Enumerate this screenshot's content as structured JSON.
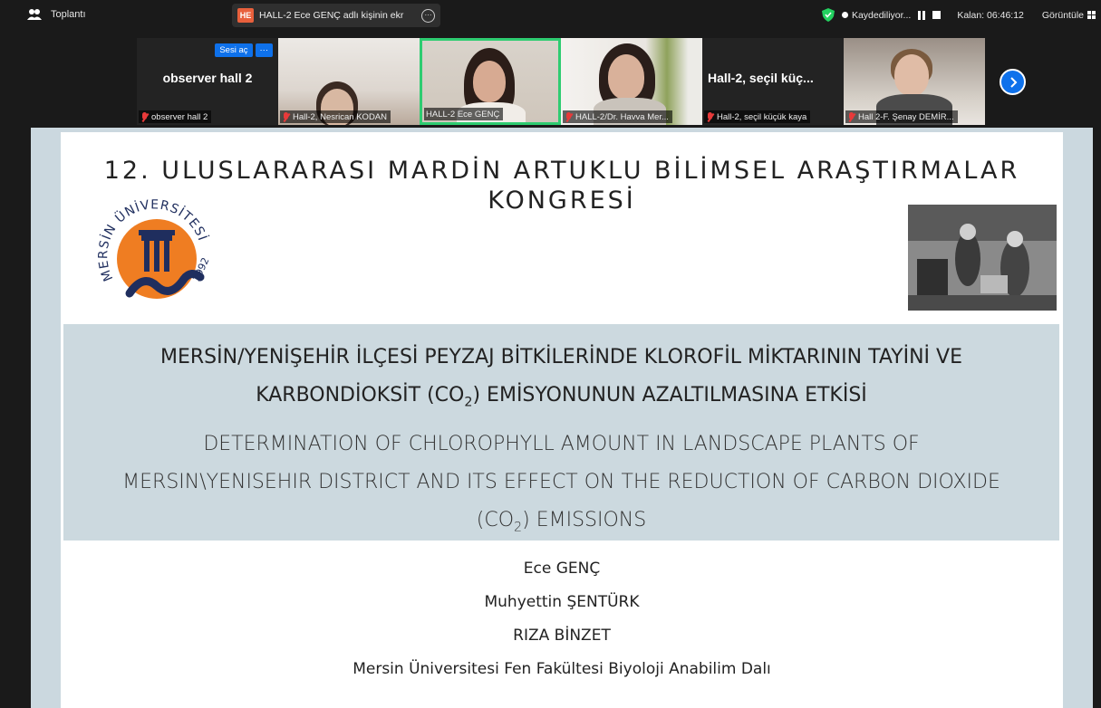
{
  "topbar": {
    "app_label": "Toplantı",
    "share_badge": "HE",
    "share_text": "HALL-2 Ece GENÇ adlı kişinin ekr",
    "recording_label": "Kaydediliyor...",
    "remaining_label": "Kalan: 06:46:12",
    "view_label": "Görüntüle"
  },
  "participants": [
    {
      "big_name": "observer hall 2",
      "label": "observer hall 2",
      "unmute": "Sesi aç",
      "more": "···"
    },
    {
      "label": "Hall-2, Nesrican KODAN"
    },
    {
      "label": "HALL-2 Ece GENÇ"
    },
    {
      "label": "HALL-2/Dr. Havva Mer..."
    },
    {
      "big_name": "Hall-2, seçil küç...",
      "label": "Hall-2, seçil küçük kaya"
    },
    {
      "label": "Hall 2-F. Şenay DEMİR..."
    }
  ],
  "slide": {
    "congress_line1": "12. ULUSLARARASI MARDİN ARTUKLU BİLİMSEL ARAŞTIRMALAR",
    "congress_line2": "KONGRESİ",
    "logo": {
      "arc_text": "MERSİN ÜNİVERSİTESİ",
      "year": "1992",
      "orange": "#ef7d22",
      "navy": "#1f2e5e"
    },
    "tr_title_line1": "MERSİN/YENİŞEHİR İLÇESİ PEYZAJ BİTKİLERİNDE KLOROFİL MİKTARININ TAYİNİ VE",
    "tr_title_line2_pre": "KARBONDİOKSİT (CO",
    "tr_title_line2_sub": "2",
    "tr_title_line2_post": ") EMİSYONUNUN AZALTILMASINA ETKİSİ",
    "en_title_line1": "DETERMINATION OF CHLOROPHYLL AMOUNT IN LANDSCAPE PLANTS OF",
    "en_title_line2": "MERSIN\\YENISEHIR DISTRICT AND ITS EFFECT ON THE REDUCTION OF CARBON DIOXIDE",
    "en_title_line3_pre": "(CO",
    "en_title_line3_sub": "2",
    "en_title_line3_post": ") EMISSIONS",
    "authors": [
      "Ece GENÇ",
      "Muhyettin ŞENTÜRK",
      "RIZA BİNZET",
      "Mersin Üniversitesi Fen Fakültesi Biyoloji Anabilim Dalı"
    ]
  },
  "colors": {
    "active_speaker": "#2ecc71",
    "accent_blue": "#0e71eb",
    "slide_band": "#ccd9df"
  }
}
